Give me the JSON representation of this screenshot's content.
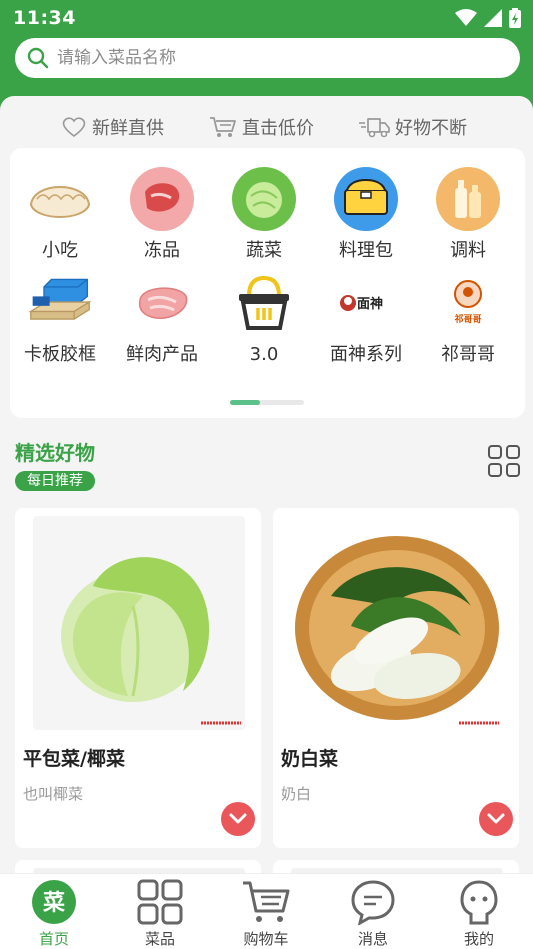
{
  "status_bar": {
    "time": "11:34"
  },
  "search": {
    "placeholder": "请输入菜品名称"
  },
  "features": [
    {
      "label": "新鲜直供",
      "icon": "heart-icon"
    },
    {
      "label": "直击低价",
      "icon": "cart-icon"
    },
    {
      "label": "好物不断",
      "icon": "truck-icon"
    }
  ],
  "categories": [
    {
      "label": "小吃",
      "icon": "dumpling-icon"
    },
    {
      "label": "冻品",
      "icon": "meat-icon"
    },
    {
      "label": "蔬菜",
      "icon": "cabbage-icon"
    },
    {
      "label": "料理包",
      "icon": "lunchbox-icon"
    },
    {
      "label": "调料",
      "icon": "bottles-icon"
    },
    {
      "label": "卡板胶框",
      "icon": "pallet-icon"
    },
    {
      "label": "鲜肉产品",
      "icon": "raw-meat-icon"
    },
    {
      "label": "3.0",
      "icon": "basket-icon"
    },
    {
      "label": "面神系列",
      "icon": "mianshen-logo"
    },
    {
      "label": "祁哥哥",
      "icon": "qigege-logo"
    }
  ],
  "category_logos": {
    "mianshen": "面神",
    "qigege": "祁哥哥"
  },
  "pagination": {
    "page": 1,
    "pages": 2
  },
  "section": {
    "title": "精选好物",
    "badge": "每日推荐"
  },
  "products": [
    {
      "name": "平包菜/椰菜",
      "desc": "也叫椰菜"
    },
    {
      "name": "奶白菜",
      "desc": "奶白"
    }
  ],
  "tabbar": [
    {
      "label": "首页",
      "active": true,
      "glyph": "菜"
    },
    {
      "label": "菜品",
      "active": false
    },
    {
      "label": "购物车",
      "active": false
    },
    {
      "label": "消息",
      "active": false
    },
    {
      "label": "我的",
      "active": false
    }
  ],
  "colors": {
    "brand_green": "#3aa348",
    "add_red": "#e9575b",
    "indicator": "#5cc08a"
  }
}
